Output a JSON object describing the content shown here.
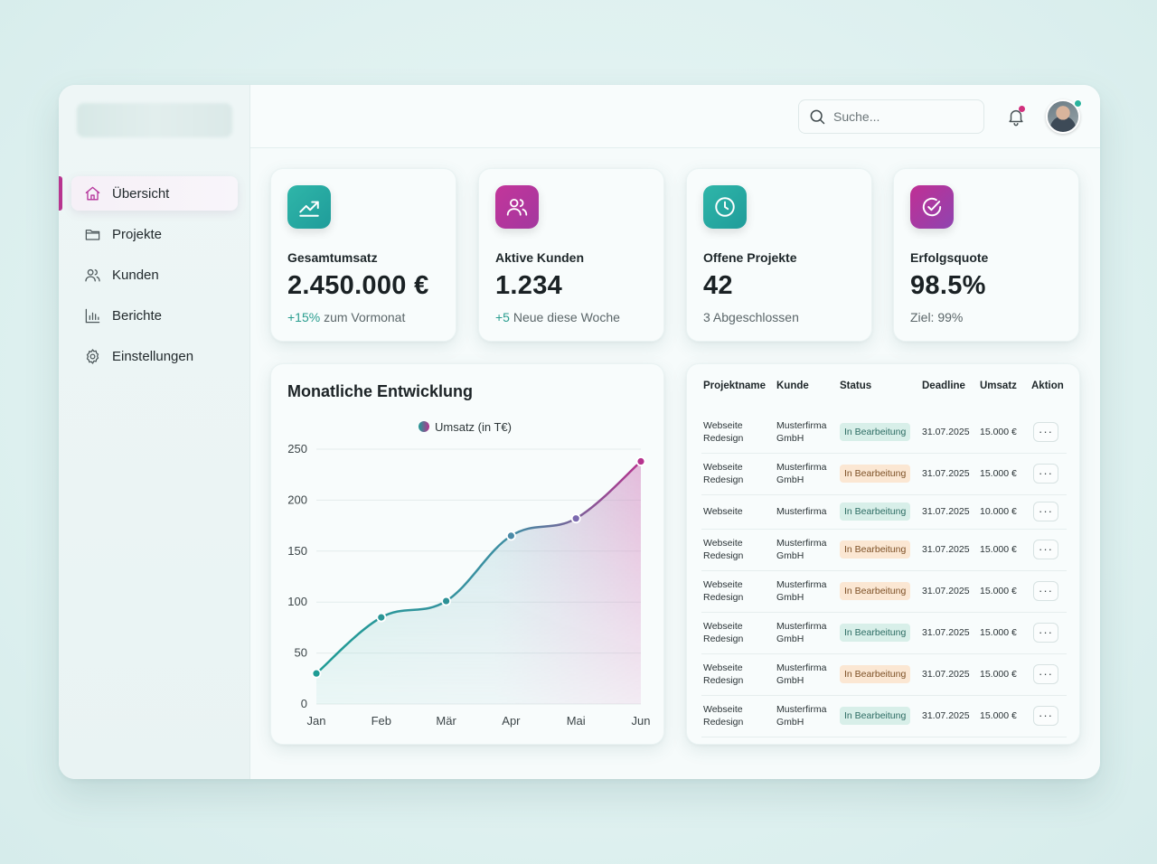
{
  "sidebar": {
    "items": [
      {
        "label": "Übersicht",
        "icon": "home-icon",
        "active": true
      },
      {
        "label": "Projekte",
        "icon": "folder-icon"
      },
      {
        "label": "Kunden",
        "icon": "users-icon"
      },
      {
        "label": "Berichte",
        "icon": "bar-chart-icon"
      },
      {
        "label": "Einstellungen",
        "icon": "gear-icon"
      }
    ]
  },
  "header": {
    "search_placeholder": "Suche...",
    "notification_icon": "bell-icon",
    "avatar": "user-avatar"
  },
  "kpis": [
    {
      "title": "Gesamtumsatz",
      "value": "2.450.000 €",
      "sub_highlight": "+15%",
      "sub_text": " zum Vormonat",
      "icon": "trending-up-icon",
      "color": "#25a9a0"
    },
    {
      "title": "Aktive Kunden",
      "value": "1.234",
      "sub_highlight": "+5",
      "sub_text": " Neue diese Woche",
      "icon": "users-icon",
      "color": "#b6369c"
    },
    {
      "title": "Offene Projekte",
      "value": "42",
      "sub_highlight": "",
      "sub_text": "3 Abgeschlossen",
      "icon": "clock-icon",
      "color": "#25a9a0"
    },
    {
      "title": "Erfolgsquote",
      "value": "98.5%",
      "sub_highlight": "",
      "sub_text": "Ziel: 99%",
      "icon": "check-circle-icon",
      "color": "#b6369c"
    }
  ],
  "chart": {
    "title": "Monatliche Entwicklung"
  },
  "chart_data": {
    "type": "area",
    "categories": [
      "Jan",
      "Feb",
      "Mär",
      "Apr",
      "Mai",
      "Jun"
    ],
    "series": [
      {
        "name": "Umsatz (in T€)",
        "values": [
          30,
          85,
          101,
          165,
          182,
          238
        ]
      }
    ],
    "title": "Monatliche Entwicklung",
    "xlabel": "",
    "ylabel": "",
    "ylim": [
      0,
      250
    ],
    "yticks": [
      0,
      50,
      100,
      150,
      200,
      250
    ],
    "grid": true,
    "legend": "top-center",
    "colors": {
      "start": "#1f9c95",
      "end": "#b6338e"
    }
  },
  "table": {
    "headers": [
      "Projektname",
      "Kunde",
      "Status",
      "Deadline",
      "Umsatz",
      "Aktion"
    ],
    "rows": [
      {
        "name": "Webseite Redesign",
        "client": "Musterfirma GmbH",
        "status": "In Bearbeitung",
        "status_color": "green",
        "deadline": "31.07.2025",
        "amount": "15.000 €"
      },
      {
        "name": "Webseite Redesign",
        "client": "Musterfirma GmbH",
        "status": "In Bearbeitung",
        "status_color": "orange",
        "deadline": "31.07.2025",
        "amount": "15.000 €"
      },
      {
        "name": "Webseite",
        "client": "Musterfirma",
        "status": "In Bearbeitung",
        "status_color": "green",
        "deadline": "31.07.2025",
        "amount": "10.000 €"
      },
      {
        "name": "Webseite Redesign",
        "client": "Musterfirma GmbH",
        "status": "In Bearbeitung",
        "status_color": "orange",
        "deadline": "31.07.2025",
        "amount": "15.000 €"
      },
      {
        "name": "Webseite Redesign",
        "client": "Musterfirma GmbH",
        "status": "In Bearbeitung",
        "status_color": "orange",
        "deadline": "31.07.2025",
        "amount": "15.000 €"
      },
      {
        "name": "Webseite Redesign",
        "client": "Musterfirma GmbH",
        "status": "In Bearbeitung",
        "status_color": "green",
        "deadline": "31.07.2025",
        "amount": "15.000 €"
      },
      {
        "name": "Webseite Redesign",
        "client": "Musterfirma GmbH",
        "status": "In Bearbeitung",
        "status_color": "orange",
        "deadline": "31.07.2025",
        "amount": "15.000 €"
      },
      {
        "name": "Webseite Redesign",
        "client": "Musterfirma GmbH",
        "status": "In Bearbeitung",
        "status_color": "green",
        "deadline": "31.07.2025",
        "amount": "15.000 €"
      }
    ],
    "action_label": "···"
  }
}
